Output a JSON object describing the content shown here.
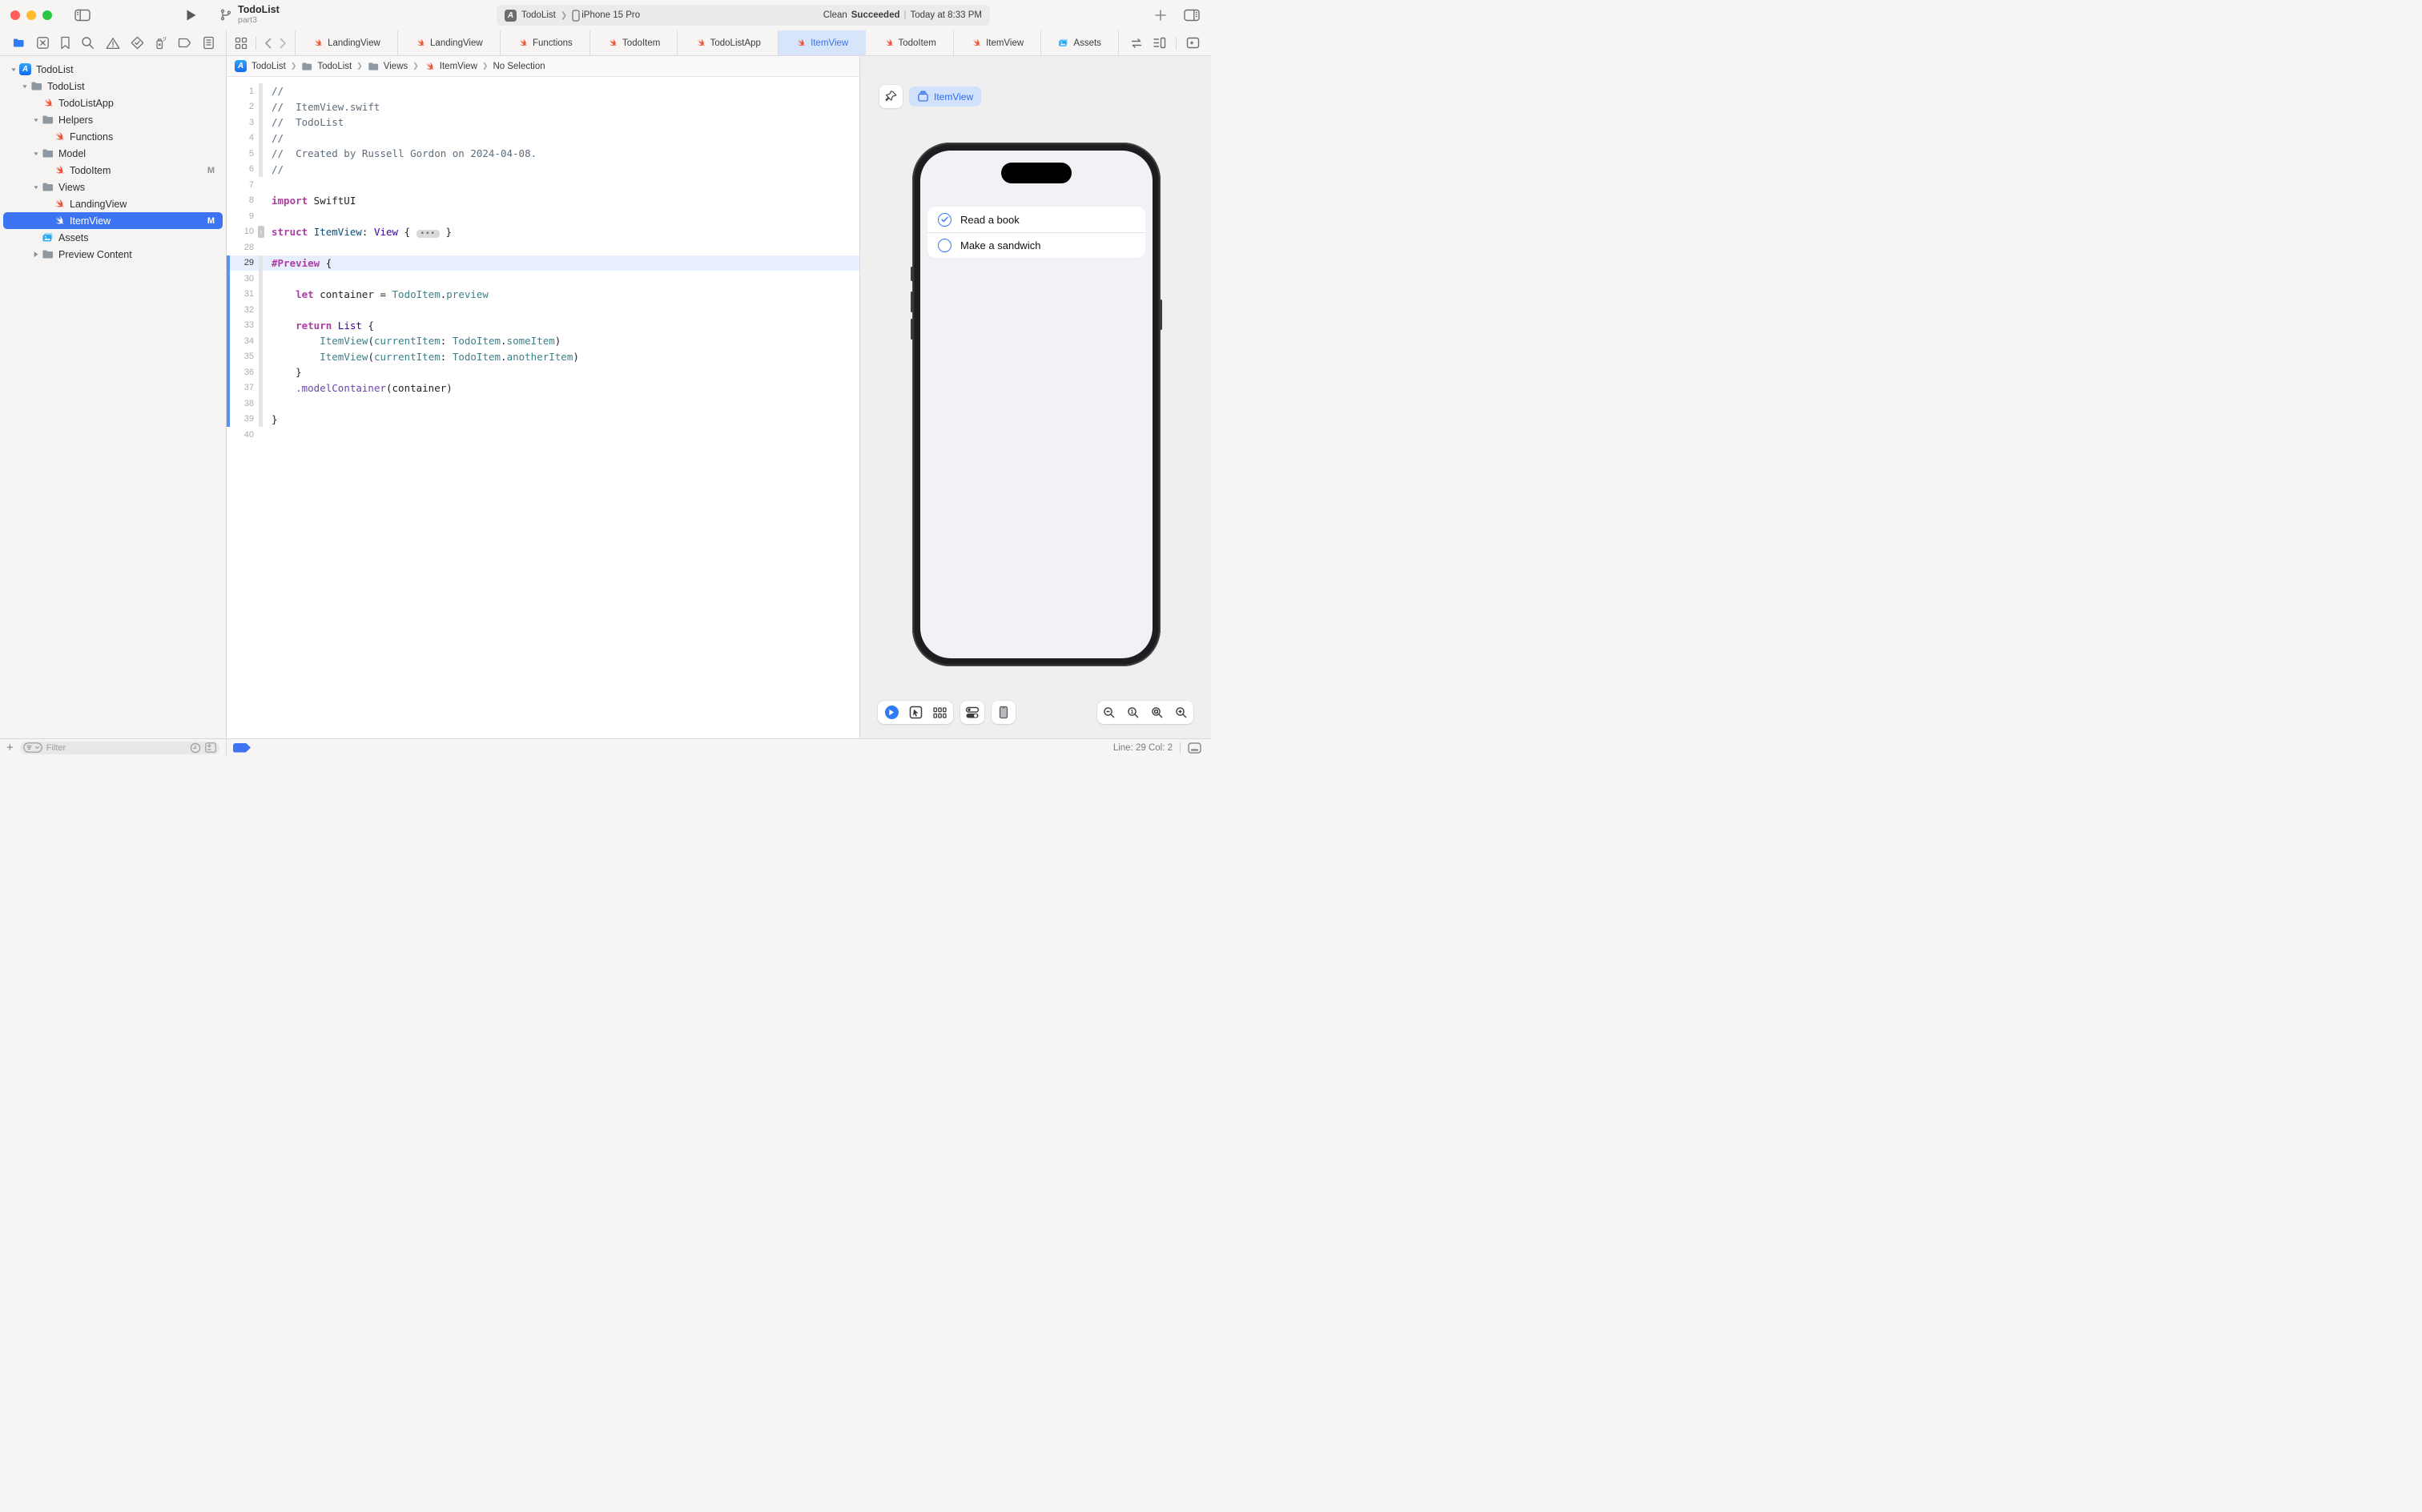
{
  "colors": {
    "accent_blue": "#3D74F4",
    "tab_selected_bg": "#D7E5FB",
    "tab_selected_text": "#3672EF",
    "swift_orange": "#F05138",
    "canvas_bg": "#EFEFF0",
    "screen_bg": "#F2F1F6",
    "todo_circle_blue": "#3478F6",
    "keyword_pink": "#AD3DA4",
    "comment_gray": "#5D6C79",
    "project_type_teal": "#3E8087",
    "sdk_type_purple": "#3900A0",
    "current_line_bg": "#E6EFFB"
  },
  "window": {
    "title": "TodoList",
    "subtitle": "part3"
  },
  "scheme": {
    "project": "TodoList",
    "device": "iPhone 15 Pro",
    "status_plain": "Clean",
    "status_bold": "Succeeded",
    "status_sep": "|",
    "status_time": "Today at 8:33 PM"
  },
  "navigator": {
    "rail_icons": [
      "folder",
      "x-square",
      "bookmark",
      "search",
      "warning",
      "check-diamond",
      "spray",
      "tag",
      "report"
    ],
    "items": [
      {
        "label": "TodoList",
        "icon": "app",
        "indent": 0,
        "disclosure": "down"
      },
      {
        "label": "TodoList",
        "icon": "folder",
        "indent": 1,
        "disclosure": "down"
      },
      {
        "label": "TodoListApp",
        "icon": "swift",
        "indent": 2,
        "disclosure": "none"
      },
      {
        "label": "Helpers",
        "icon": "folder",
        "indent": 2,
        "disclosure": "down"
      },
      {
        "label": "Functions",
        "icon": "swift",
        "indent": 3,
        "disclosure": "none"
      },
      {
        "label": "Model",
        "icon": "folder",
        "indent": 2,
        "disclosure": "down"
      },
      {
        "label": "TodoItem",
        "icon": "swift",
        "indent": 3,
        "disclosure": "none",
        "badge": "M"
      },
      {
        "label": "Views",
        "icon": "folder",
        "indent": 2,
        "disclosure": "down"
      },
      {
        "label": "LandingView",
        "icon": "swift",
        "indent": 3,
        "disclosure": "none"
      },
      {
        "label": "ItemView",
        "icon": "swift",
        "indent": 3,
        "disclosure": "none",
        "badge": "M",
        "selected": true
      },
      {
        "label": "Assets",
        "icon": "assets",
        "indent": 2,
        "disclosure": "none"
      },
      {
        "label": "Preview Content",
        "icon": "folder",
        "indent": 2,
        "disclosure": "right"
      }
    ]
  },
  "tabs": [
    {
      "label": "LandingView",
      "icon": "swift"
    },
    {
      "label": "LandingView",
      "icon": "swift"
    },
    {
      "label": "Functions",
      "icon": "swift"
    },
    {
      "label": "TodoItem",
      "icon": "swift"
    },
    {
      "label": "TodoListApp",
      "icon": "swift"
    },
    {
      "label": "ItemView",
      "icon": "swift",
      "selected": true
    },
    {
      "label": "TodoItem",
      "icon": "swift"
    },
    {
      "label": "ItemView",
      "icon": "swift"
    },
    {
      "label": "Assets",
      "icon": "assets"
    }
  ],
  "breadcrumb": {
    "items": [
      {
        "label": "TodoList",
        "icon": "app"
      },
      {
        "label": "TodoList",
        "icon": "folder"
      },
      {
        "label": "Views",
        "icon": "folder"
      },
      {
        "label": "ItemView",
        "icon": "swift"
      },
      {
        "label": "No Selection",
        "icon": "none"
      }
    ]
  },
  "editor": {
    "lines": [
      {
        "n": "1",
        "ribbon": true,
        "tokens": [
          [
            "c",
            "//"
          ]
        ]
      },
      {
        "n": "2",
        "ribbon": true,
        "tokens": [
          [
            "c",
            "//  ItemView.swift"
          ]
        ]
      },
      {
        "n": "3",
        "ribbon": true,
        "tokens": [
          [
            "c",
            "//  TodoList"
          ]
        ]
      },
      {
        "n": "4",
        "ribbon": true,
        "tokens": [
          [
            "c",
            "//"
          ]
        ]
      },
      {
        "n": "5",
        "ribbon": true,
        "tokens": [
          [
            "c",
            "//  Created by Russell Gordon on 2024-04-08."
          ]
        ]
      },
      {
        "n": "6",
        "ribbon": true,
        "tokens": [
          [
            "c",
            "//"
          ]
        ]
      },
      {
        "n": "7",
        "tokens": []
      },
      {
        "n": "8",
        "tokens": [
          [
            "k",
            "import"
          ],
          [
            "p",
            " SwiftUI"
          ]
        ]
      },
      {
        "n": "9",
        "tokens": []
      },
      {
        "n": "10",
        "foldmark": true,
        "tokens": [
          [
            "k",
            "struct"
          ],
          [
            "p",
            " "
          ],
          [
            "d",
            "ItemView"
          ],
          [
            "p",
            ": "
          ],
          [
            "s",
            "View"
          ],
          [
            "p",
            " { "
          ],
          [
            "fold",
            "•••"
          ],
          [
            "p",
            " }"
          ]
        ]
      },
      {
        "n": "28",
        "tokens": []
      },
      {
        "n": "29",
        "highlight": true,
        "changed": true,
        "ribbon": true,
        "tokens": [
          [
            "k",
            "#Preview"
          ],
          [
            "p",
            " {"
          ]
        ]
      },
      {
        "n": "30",
        "changed": true,
        "ribbon": true,
        "tokens": []
      },
      {
        "n": "31",
        "changed": true,
        "ribbon": true,
        "tokens": [
          [
            "p",
            "    "
          ],
          [
            "k",
            "let"
          ],
          [
            "p",
            " container = "
          ],
          [
            "t",
            "TodoItem"
          ],
          [
            "p",
            "."
          ],
          [
            "t",
            "preview"
          ]
        ]
      },
      {
        "n": "32",
        "changed": true,
        "ribbon": true,
        "tokens": []
      },
      {
        "n": "33",
        "changed": true,
        "ribbon": true,
        "tokens": [
          [
            "p",
            "    "
          ],
          [
            "k",
            "return"
          ],
          [
            "p",
            " "
          ],
          [
            "s",
            "List"
          ],
          [
            "p",
            " {"
          ]
        ]
      },
      {
        "n": "34",
        "changed": true,
        "ribbon": true,
        "tokens": [
          [
            "p",
            "        "
          ],
          [
            "t",
            "ItemView"
          ],
          [
            "p",
            "("
          ],
          [
            "t",
            "currentItem"
          ],
          [
            "p",
            ": "
          ],
          [
            "t",
            "TodoItem"
          ],
          [
            "p",
            "."
          ],
          [
            "t",
            "someItem"
          ],
          [
            "p",
            ")"
          ]
        ]
      },
      {
        "n": "35",
        "changed": true,
        "ribbon": true,
        "tokens": [
          [
            "p",
            "        "
          ],
          [
            "t",
            "ItemView"
          ],
          [
            "p",
            "("
          ],
          [
            "t",
            "currentItem"
          ],
          [
            "p",
            ": "
          ],
          [
            "t",
            "TodoItem"
          ],
          [
            "p",
            "."
          ],
          [
            "t",
            "anotherItem"
          ],
          [
            "p",
            ")"
          ]
        ]
      },
      {
        "n": "36",
        "changed": true,
        "ribbon": true,
        "tokens": [
          [
            "p",
            "    }"
          ]
        ]
      },
      {
        "n": "37",
        "changed": true,
        "ribbon": true,
        "tokens": [
          [
            "p",
            "    "
          ],
          [
            "m",
            ".modelContainer"
          ],
          [
            "p",
            "(container)"
          ]
        ]
      },
      {
        "n": "38",
        "changed": true,
        "ribbon": true,
        "tokens": []
      },
      {
        "n": "39",
        "changed": true,
        "ribbon": true,
        "tokens": [
          [
            "p",
            "}"
          ]
        ]
      },
      {
        "n": "40",
        "tokens": []
      }
    ],
    "status_line_col": "Line: 29  Col: 2"
  },
  "preview": {
    "chip_label": "ItemView",
    "todo_items": [
      {
        "label": "Read a book",
        "done": true
      },
      {
        "label": "Make a sandwich",
        "done": false
      }
    ]
  },
  "filter": {
    "placeholder": "Filter"
  }
}
